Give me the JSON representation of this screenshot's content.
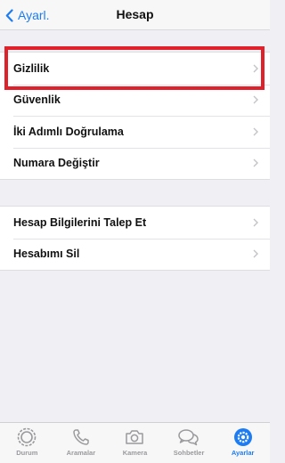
{
  "navbar": {
    "back_label": "Ayarl.",
    "title": "Hesap"
  },
  "group1": {
    "items": [
      {
        "label": "Gizlilik"
      },
      {
        "label": "Güvenlik"
      },
      {
        "label": "İki Adımlı Doğrulama"
      },
      {
        "label": "Numara Değiştir"
      }
    ]
  },
  "group2": {
    "items": [
      {
        "label": "Hesap Bilgilerini Talep Et"
      },
      {
        "label": "Hesabımı Sil"
      }
    ]
  },
  "highlight": {
    "target": "Gizlilik",
    "color": "#e0202a"
  },
  "tabbar": {
    "tabs": [
      {
        "label": "Durum",
        "icon": "status-icon",
        "active": false
      },
      {
        "label": "Aramalar",
        "icon": "phone-icon",
        "active": false
      },
      {
        "label": "Kamera",
        "icon": "camera-icon",
        "active": false
      },
      {
        "label": "Sohbetler",
        "icon": "chats-icon",
        "active": false
      },
      {
        "label": "Ayarlar",
        "icon": "settings-gear-icon",
        "active": true
      }
    ]
  },
  "colors": {
    "accent": "#1c7cf4",
    "inactive": "#9a9a9e",
    "background": "#efeff4"
  }
}
